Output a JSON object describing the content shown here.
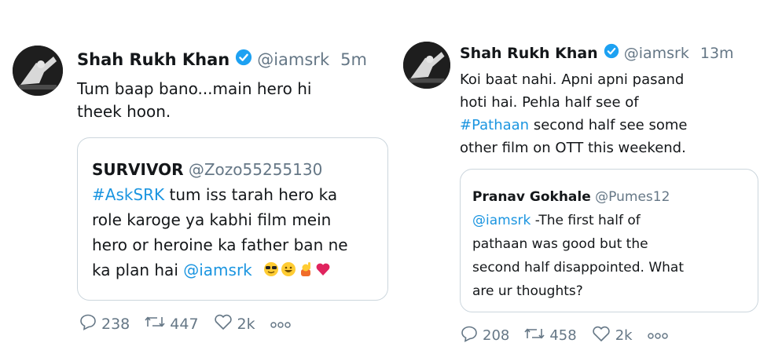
{
  "tweets": [
    {
      "name": "Shah Rukh Khan",
      "handle": "@iamsrk",
      "time": "5m",
      "body_line1": "Tum baap bano...main hero hi",
      "body_line2": "theek hoon.",
      "quote": {
        "name": "SURVIVOR",
        "handle": "@Zozo55255130",
        "hashtag": "#AskSRK",
        "line1_rest": " tum iss tarah hero ka",
        "line2": "role karoge ya kabhi film mein",
        "line3": "hero or heroine ka father ban ne",
        "line4_prefix": "ka plan hai ",
        "mention": "@iamsrk",
        "emojis": [
          "sunglasses-emoji",
          "grin-emoji",
          "raising-hand-emoji",
          "red-heart-emoji"
        ]
      },
      "actions": {
        "replies": "238",
        "retweets": "447",
        "likes": "2k"
      }
    },
    {
      "name": "Shah Rukh Khan",
      "handle": "@iamsrk",
      "time": "13m",
      "body_line1": "Koi baat nahi. Apni apni pasand",
      "body_line2": "hoti hai. Pehla half see of",
      "hashtag": "#Pathaan",
      "body_line3_rest": " second half see some",
      "body_line4": "other film on OTT this weekend.",
      "quote": {
        "name": "Pranav Gokhale",
        "handle": "@Pumes12",
        "mention": "@iamsrk",
        "line1_rest": " -The first half of",
        "line2": "pathaan was good but the",
        "line3": "second half disappointed. What",
        "line4": "are ur thoughts?"
      },
      "actions": {
        "replies": "208",
        "retweets": "458",
        "likes": "2k"
      }
    }
  ],
  "colors": {
    "link": "#1b95e0",
    "verified": "#1da1f2",
    "muted": "#657786",
    "heart": "#e0245e"
  }
}
